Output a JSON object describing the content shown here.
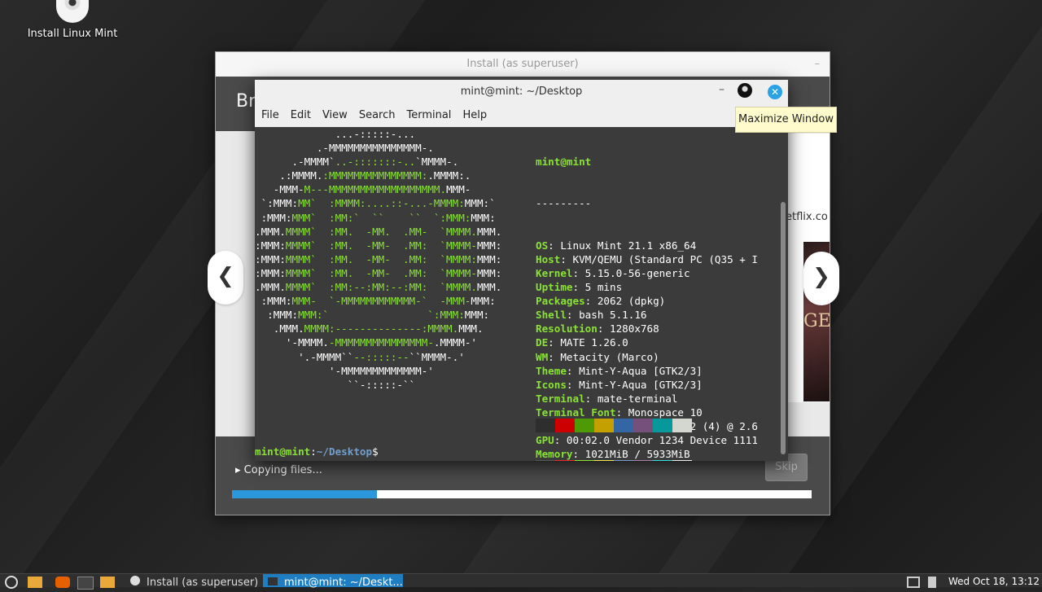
{
  "desktop": {
    "icon_label": "Install Linux Mint"
  },
  "installer": {
    "title": "Install (as superuser)",
    "min_glyph": "–",
    "header_text": "Br",
    "slide_url": "etflix.co",
    "slide_image_text": "GE",
    "prev_glyph": "❮",
    "next_glyph": "❯",
    "status": "Copying files...",
    "expander_glyph": "▸",
    "skip_label": "Skip",
    "progress_pct": 25
  },
  "terminal": {
    "title": "mint@mint: ~/Desktop",
    "close_glyph": "✕",
    "min_glyph": "–",
    "menu": [
      "File",
      "Edit",
      "View",
      "Search",
      "Terminal",
      "Help"
    ],
    "ascii_lines": [
      [
        [
          "w",
          "             ...-:::::-..."
        ]
      ],
      [
        [
          "w",
          "          .-MMMMMMMMMMMMMMM-."
        ]
      ],
      [
        [
          "w",
          "      .-MMMM`"
        ],
        [
          "g",
          "..-:::::::-.."
        ],
        [
          "w",
          "`MMMM-."
        ]
      ],
      [
        [
          "w",
          "    .:MMMM."
        ],
        [
          "g",
          ":MMMMMMMMMMMMMMM:"
        ],
        [
          "w",
          ".MMMM:."
        ]
      ],
      [
        [
          "w",
          "   -MMM-"
        ],
        [
          "g",
          "M---MMMMMMMMMMMMMMMMMM."
        ],
        [
          "w",
          "MMM-"
        ]
      ],
      [
        [
          "w",
          " `:MMM:"
        ],
        [
          "g",
          "MM`  :MMMM:....::-...-MMMM:"
        ],
        [
          "w",
          "MMM:`"
        ]
      ],
      [
        [
          "w",
          " :MMM:"
        ],
        [
          "g",
          "MMM`  :MM:`  ``    ``  `:MMM:"
        ],
        [
          "w",
          "MMM:"
        ]
      ],
      [
        [
          "w",
          ".MMM."
        ],
        [
          "g",
          "MMMM`  :MM.  -MM.  .MM-  `MMMM."
        ],
        [
          "w",
          "MMM."
        ]
      ],
      [
        [
          "w",
          ":MMM:"
        ],
        [
          "g",
          "MMMM`  :MM.  -MM-  .MM:  `MMMM-"
        ],
        [
          "w",
          "MMM:"
        ]
      ],
      [
        [
          "w",
          ":MMM:"
        ],
        [
          "g",
          "MMMM`  :MM.  -MM-  .MM:  `MMMM:"
        ],
        [
          "w",
          "MMM:"
        ]
      ],
      [
        [
          "w",
          ":MMM:"
        ],
        [
          "g",
          "MMMM`  :MM.  -MM-  .MM:  `MMMM-"
        ],
        [
          "w",
          "MMM:"
        ]
      ],
      [
        [
          "w",
          ".MMM."
        ],
        [
          "g",
          "MMMM`  :MM:--:MM:--:MM:  `MMMM."
        ],
        [
          "w",
          "MMM."
        ]
      ],
      [
        [
          "w",
          " :MMM:"
        ],
        [
          "g",
          "MMM-  `-MMMMMMMMMMMM-`  -MMM-"
        ],
        [
          "w",
          "MMM:"
        ]
      ],
      [
        [
          "w",
          "  :MMM:"
        ],
        [
          "g",
          "MMM:`                `:MMM:"
        ],
        [
          "w",
          "MMM:"
        ]
      ],
      [
        [
          "w",
          "   .MMM."
        ],
        [
          "g",
          "MMMM:--------------:MMMM."
        ],
        [
          "w",
          "MMM."
        ]
      ],
      [
        [
          "w",
          "     '-MMMM."
        ],
        [
          "g",
          "-MMMMMMMMMMMMMMM-"
        ],
        [
          "w",
          ".MMMM-'"
        ]
      ],
      [
        [
          "w",
          "       '.-MMMM``"
        ],
        [
          "g",
          "--:::::--"
        ],
        [
          "w",
          "``MMMM-.'"
        ]
      ],
      [
        [
          "w",
          "            '-MMMMMMMMMMMMM-'"
        ]
      ],
      [
        [
          "w",
          "               ``-:::::-``"
        ]
      ]
    ],
    "info_header": "mint@mint",
    "info_sep": "---------",
    "info": [
      {
        "k": "OS",
        "v": "Linux Mint 21.1 x86_64"
      },
      {
        "k": "Host",
        "v": "KVM/QEMU (Standard PC (Q35 + I"
      },
      {
        "k": "Kernel",
        "v": "5.15.0-56-generic"
      },
      {
        "k": "Uptime",
        "v": "5 mins"
      },
      {
        "k": "Packages",
        "v": "2062 (dpkg)"
      },
      {
        "k": "Shell",
        "v": "bash 5.1.16"
      },
      {
        "k": "Resolution",
        "v": "1280x768"
      },
      {
        "k": "DE",
        "v": "MATE 1.26.0"
      },
      {
        "k": "WM",
        "v": "Metacity (Marco)"
      },
      {
        "k": "Theme",
        "v": "Mint-Y-Aqua [GTK2/3]"
      },
      {
        "k": "Icons",
        "v": "Mint-Y-Aqua [GTK2/3]"
      },
      {
        "k": "Terminal",
        "v": "mate-terminal"
      },
      {
        "k": "Terminal Font",
        "v": "Monospace 10"
      },
      {
        "k": "CPU",
        "v": "Intel Xeon E5-2697 v2 (4) @ 2.6"
      },
      {
        "k": "GPU",
        "v": "00:02.0 Vendor 1234 Device 1111"
      },
      {
        "k": "Memory",
        "v": "1021MiB / 5933MiB"
      }
    ],
    "palette_top": [
      "#2e2e2e",
      "#cc0000",
      "#4e9a06",
      "#c4a000",
      "#3465a4",
      "#75507b",
      "#06989a",
      "#d3d7cf"
    ],
    "palette_bottom": [
      "#555753",
      "#ef2929",
      "#8ae234",
      "#fce94f",
      "#729fcf",
      "#ad7fa8",
      "#34e2e2",
      "#eeeeec"
    ],
    "prompt_user": "mint@mint",
    "prompt_colon": ":",
    "prompt_path": "~/Desktop",
    "prompt_symbol": "$"
  },
  "tooltip": "Maximize Window",
  "taskbar": {
    "tasks": [
      "Install (as superuser)",
      "mint@mint: ~/Deskt..."
    ],
    "clock": "Wed Oct 18, 13:12"
  }
}
